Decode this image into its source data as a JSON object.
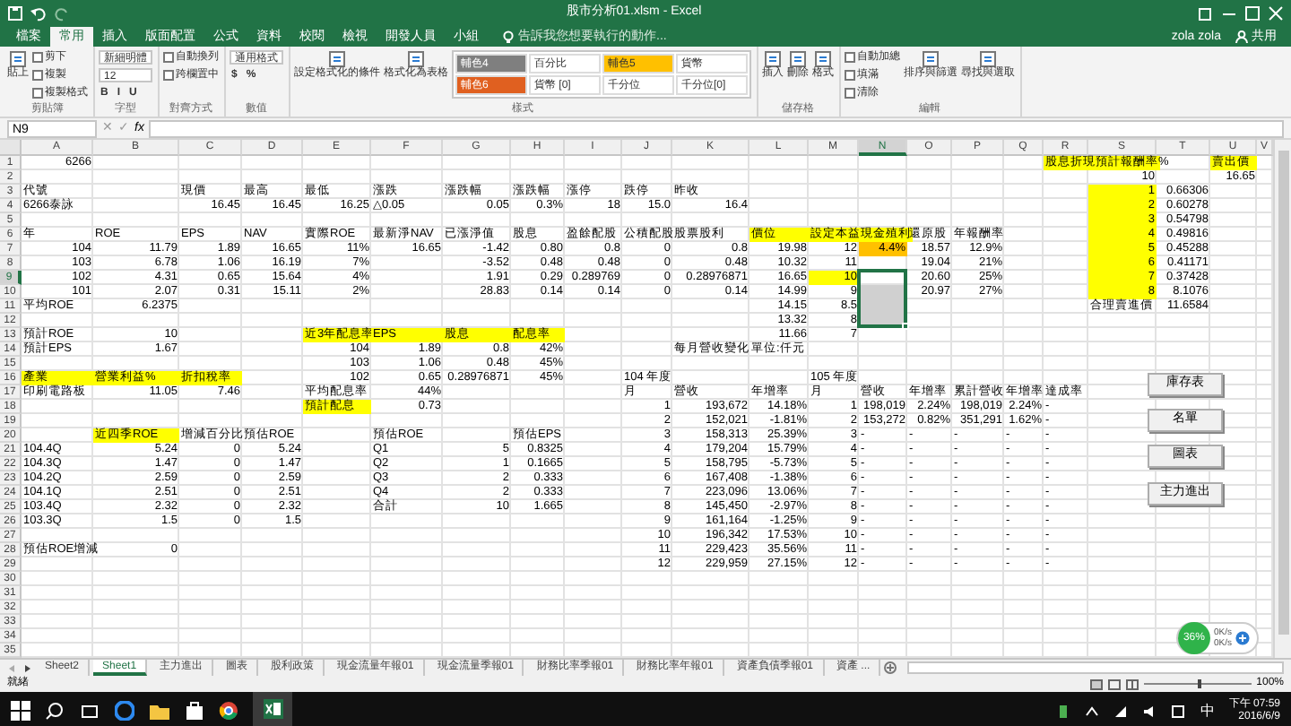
{
  "window": {
    "title": "股市分析01.xlsm - Excel",
    "user": "zola zola",
    "share": "共用"
  },
  "ribbon_tabs": [
    {
      "label": "檔案",
      "selected": false
    },
    {
      "label": "常用",
      "selected": true
    },
    {
      "label": "插入",
      "selected": false
    },
    {
      "label": "版面配置",
      "selected": false
    },
    {
      "label": "公式",
      "selected": false
    },
    {
      "label": "資料",
      "selected": false
    },
    {
      "label": "校閱",
      "selected": false
    },
    {
      "label": "檢視",
      "selected": false
    },
    {
      "label": "開發人員",
      "selected": false
    },
    {
      "label": "小組",
      "selected": false
    }
  ],
  "tell_me": "告訴我您想要執行的動作...",
  "ribbon": {
    "groups": [
      {
        "label": "剪貼簿",
        "items": [
          {
            "text": "貼上",
            "kind": "large"
          },
          {
            "text": "剪下",
            "kind": "small"
          },
          {
            "text": "複製",
            "kind": "small"
          },
          {
            "text": "複製格式",
            "kind": "small"
          }
        ]
      },
      {
        "label": "字型",
        "items": [
          {
            "text": "新細明體",
            "kind": "field"
          },
          {
            "text": "12",
            "kind": "field"
          },
          {
            "text": "B",
            "kind": "toggle"
          },
          {
            "text": "I",
            "kind": "toggle"
          },
          {
            "text": "U",
            "kind": "toggle"
          }
        ]
      },
      {
        "label": "對齊方式",
        "items": [
          {
            "text": "自動換列",
            "kind": "small"
          },
          {
            "text": "跨欄置中",
            "kind": "small"
          }
        ]
      },
      {
        "label": "數值",
        "items": [
          {
            "text": "通用格式",
            "kind": "field"
          },
          {
            "text": "$",
            "kind": "toggle"
          },
          {
            "text": "%",
            "kind": "toggle"
          }
        ]
      },
      {
        "label": "樣式",
        "items": [
          {
            "text": "設定格式化的條件",
            "kind": "large"
          },
          {
            "text": "格式化為表格",
            "kind": "large"
          },
          {
            "text": "輔色4",
            "kind": "swatch",
            "color": "#7f7f7f"
          },
          {
            "text": "百分比",
            "kind": "swatch",
            "color": "#ffffff"
          },
          {
            "text": "輔色5",
            "kind": "swatch",
            "color": "#ffc000"
          },
          {
            "text": "貨幣",
            "kind": "swatch",
            "color": "#ffffff"
          },
          {
            "text": "輔色6",
            "kind": "swatch",
            "color": "#e06020"
          },
          {
            "text": "貨幣 [0]",
            "kind": "swatch",
            "color": "#ffffff"
          },
          {
            "text": "千分位",
            "kind": "swatch",
            "color": "#ffffff"
          },
          {
            "text": "千分位[0]",
            "kind": "swatch",
            "color": "#ffffff"
          }
        ]
      },
      {
        "label": "儲存格",
        "items": [
          {
            "text": "插入",
            "kind": "large"
          },
          {
            "text": "刪除",
            "kind": "large"
          },
          {
            "text": "格式",
            "kind": "large"
          }
        ]
      },
      {
        "label": "編輯",
        "items": [
          {
            "text": "自動加總",
            "kind": "small"
          },
          {
            "text": "填滿",
            "kind": "small"
          },
          {
            "text": "清除",
            "kind": "small"
          },
          {
            "text": "排序與篩選",
            "kind": "large"
          },
          {
            "text": "尋找與選取",
            "kind": "large"
          }
        ]
      }
    ]
  },
  "formula_bar": {
    "name_box": "N9",
    "cancel": "✕",
    "enter": "✓",
    "fx": "fx"
  },
  "columns": [
    {
      "label": "A",
      "selected": false
    },
    {
      "label": "B",
      "selected": false
    },
    {
      "label": "C",
      "selected": false
    },
    {
      "label": "D",
      "selected": false
    },
    {
      "label": "E",
      "selected": false
    },
    {
      "label": "F",
      "selected": false
    },
    {
      "label": "G",
      "selected": false
    },
    {
      "label": "H",
      "selected": false
    },
    {
      "label": "I",
      "selected": false
    },
    {
      "label": "J",
      "selected": false
    },
    {
      "label": "K",
      "selected": false
    },
    {
      "label": "L",
      "selected": false
    },
    {
      "label": "M",
      "selected": false
    },
    {
      "label": "N",
      "selected": true
    },
    {
      "label": "O",
      "selected": false
    },
    {
      "label": "P",
      "selected": false
    },
    {
      "label": "Q",
      "selected": false
    },
    {
      "label": "R",
      "selected": false
    },
    {
      "label": "S",
      "selected": false
    },
    {
      "label": "T",
      "selected": false
    },
    {
      "label": "U",
      "selected": false
    },
    {
      "label": "V",
      "selected": false
    }
  ],
  "rows": [
    {
      "label": "1",
      "selected": false,
      "cells": [
        {
          "text": "6266",
          "kind": "number"
        },
        {},
        {},
        {},
        {},
        {},
        {},
        {},
        {},
        {},
        {},
        {},
        {},
        {},
        {},
        {},
        {},
        {
          "text": "股息折現預計報酬率",
          "kind": "text",
          "color": "#ffff00"
        },
        {},
        {
          "text": "%",
          "kind": "text"
        },
        {
          "text": "賣出價",
          "kind": "text",
          "color": "#ffff00"
        }
      ]
    },
    {
      "label": "2",
      "selected": false,
      "cells": [
        {},
        {},
        {},
        {},
        {},
        {},
        {},
        {},
        {},
        {},
        {},
        {},
        {},
        {},
        {},
        {},
        {},
        {},
        {
          "text": "10",
          "kind": "number"
        },
        {},
        {
          "text": "16.65",
          "kind": "number"
        }
      ]
    },
    {
      "label": "3",
      "selected": false,
      "cells": [
        {
          "text": "代號",
          "kind": "text"
        },
        {},
        {
          "text": "現價",
          "kind": "text"
        },
        {
          "text": "最高",
          "kind": "text"
        },
        {
          "text": "最低",
          "kind": "text"
        },
        {
          "text": "漲跌",
          "kind": "text"
        },
        {
          "text": "漲跌幅",
          "kind": "text"
        },
        {
          "text": "漲跌幅",
          "kind": "text"
        },
        {
          "text": "漲停",
          "kind": "text"
        },
        {
          "text": "跌停",
          "kind": "text"
        },
        {
          "text": "昨收",
          "kind": "text"
        },
        {},
        {},
        {},
        {},
        {},
        {},
        {},
        {
          "text": "1",
          "kind": "number",
          "color": "#ffff00"
        },
        {
          "text": "0.66306",
          "kind": "number"
        }
      ]
    },
    {
      "label": "4",
      "selected": false,
      "cells": [
        {
          "text": "6266泰詠",
          "kind": "text"
        },
        {},
        {
          "text": "16.45",
          "kind": "number"
        },
        {
          "text": "16.45",
          "kind": "number"
        },
        {
          "text": "16.25",
          "kind": "number"
        },
        {
          "text": "△0.05",
          "kind": "text"
        },
        {
          "text": "0.05",
          "kind": "number"
        },
        {
          "text": "0.3%",
          "kind": "number"
        },
        {
          "text": "18",
          "kind": "number"
        },
        {
          "text": "15.0",
          "kind": "number"
        },
        {
          "text": "16.4",
          "kind": "number"
        },
        {},
        {},
        {},
        {},
        {},
        {},
        {},
        {
          "text": "2",
          "kind": "number",
          "color": "#ffff00"
        },
        {
          "text": "0.60278",
          "kind": "number"
        }
      ]
    },
    {
      "label": "5",
      "selected": false,
      "cells": [
        {},
        {},
        {},
        {},
        {},
        {},
        {},
        {},
        {},
        {},
        {},
        {},
        {},
        {},
        {},
        {},
        {},
        {},
        {
          "text": "3",
          "kind": "number",
          "color": "#ffff00"
        },
        {
          "text": "0.54798",
          "kind": "number"
        }
      ]
    },
    {
      "label": "6",
      "selected": false,
      "cells": [
        {
          "text": "年",
          "kind": "text"
        },
        {
          "text": "ROE",
          "kind": "text"
        },
        {
          "text": "EPS",
          "kind": "text"
        },
        {
          "text": "NAV",
          "kind": "text"
        },
        {
          "text": "實際ROE",
          "kind": "text"
        },
        {
          "text": "最新淨NAV",
          "kind": "text"
        },
        {
          "text": "已漲淨值",
          "kind": "text"
        },
        {
          "text": "股息",
          "kind": "text"
        },
        {
          "text": "盈餘配股",
          "kind": "text"
        },
        {
          "text": "公積配股",
          "kind": "text"
        },
        {
          "text": "股票股利",
          "kind": "text"
        },
        {
          "text": "價位",
          "kind": "text",
          "color": "#ffff00"
        },
        {
          "text": "設定本益",
          "kind": "text",
          "color": "#ffff00"
        },
        {
          "text": "現金殖利",
          "kind": "text",
          "color": "#ffff00"
        },
        {
          "text": "還原股",
          "kind": "text"
        },
        {
          "text": "年報酬率",
          "kind": "text"
        },
        {},
        {},
        {
          "text": "4",
          "kind": "number",
          "color": "#ffff00"
        },
        {
          "text": "0.49816",
          "kind": "number"
        }
      ]
    },
    {
      "label": "7",
      "selected": false,
      "cells": [
        {
          "text": "104",
          "kind": "number"
        },
        {
          "text": "11.79",
          "kind": "number"
        },
        {
          "text": "1.89",
          "kind": "number"
        },
        {
          "text": "16.65",
          "kind": "number"
        },
        {
          "text": "11%",
          "kind": "number"
        },
        {
          "text": "16.65",
          "kind": "number"
        },
        {
          "text": "-1.42",
          "kind": "number"
        },
        {
          "text": "0.80",
          "kind": "number"
        },
        {
          "text": "0.8",
          "kind": "number"
        },
        {
          "text": "0",
          "kind": "number"
        },
        {
          "text": "0.8",
          "kind": "number"
        },
        {
          "text": "19.98",
          "kind": "number"
        },
        {
          "text": "12",
          "kind": "number"
        },
        {
          "text": "4.4%",
          "kind": "number",
          "color": "#ffc000"
        },
        {
          "text": "18.57",
          "kind": "number"
        },
        {
          "text": "12.9%",
          "kind": "number"
        },
        {},
        {},
        {
          "text": "5",
          "kind": "number",
          "color": "#ffff00"
        },
        {
          "text": "0.45288",
          "kind": "number"
        }
      ]
    },
    {
      "label": "8",
      "selected": false,
      "cells": [
        {
          "text": "103",
          "kind": "number"
        },
        {
          "text": "6.78",
          "kind": "number"
        },
        {
          "text": "1.06",
          "kind": "number"
        },
        {
          "text": "16.19",
          "kind": "number"
        },
        {
          "text": "7%",
          "kind": "number"
        },
        {},
        {
          "text": "-3.52",
          "kind": "number"
        },
        {
          "text": "0.48",
          "kind": "number"
        },
        {
          "text": "0.48",
          "kind": "number"
        },
        {
          "text": "0",
          "kind": "number"
        },
        {
          "text": "0.48",
          "kind": "number"
        },
        {
          "text": "10.32",
          "kind": "number"
        },
        {
          "text": "11",
          "kind": "number"
        },
        {},
        {
          "text": "19.04",
          "kind": "number"
        },
        {
          "text": "21%",
          "kind": "number"
        },
        {},
        {},
        {
          "text": "6",
          "kind": "number",
          "color": "#ffff00"
        },
        {
          "text": "0.41171",
          "kind": "number"
        }
      ]
    },
    {
      "label": "9",
      "selected": true,
      "cells": [
        {
          "text": "102",
          "kind": "number"
        },
        {
          "text": "4.31",
          "kind": "number"
        },
        {
          "text": "0.65",
          "kind": "number"
        },
        {
          "text": "15.64",
          "kind": "number"
        },
        {
          "text": "4%",
          "kind": "number"
        },
        {},
        {
          "text": "1.91",
          "kind": "number"
        },
        {
          "text": "0.29",
          "kind": "number"
        },
        {
          "text": "0.289769",
          "kind": "number"
        },
        {
          "text": "0",
          "kind": "number"
        },
        {
          "text": "0.28976871",
          "kind": "number"
        },
        {
          "text": "16.65",
          "kind": "number"
        },
        {
          "text": "10",
          "kind": "number",
          "color": "#ffff00"
        },
        {
          "selected": true
        },
        {
          "text": "20.60",
          "kind": "number"
        },
        {
          "text": "25%",
          "kind": "number"
        },
        {},
        {},
        {
          "text": "7",
          "kind": "number",
          "color": "#ffff00"
        },
        {
          "text": "0.37428",
          "kind": "number"
        }
      ]
    },
    {
      "label": "10",
      "selected": false,
      "cells": [
        {
          "text": "101",
          "kind": "number"
        },
        {
          "text": "2.07",
          "kind": "number"
        },
        {
          "text": "0.31",
          "kind": "number"
        },
        {
          "text": "15.11",
          "kind": "number"
        },
        {
          "text": "2%",
          "kind": "number"
        },
        {},
        {
          "text": "28.83",
          "kind": "number"
        },
        {
          "text": "0.14",
          "kind": "number"
        },
        {
          "text": "0.14",
          "kind": "number"
        },
        {
          "text": "0",
          "kind": "number"
        },
        {
          "text": "0.14",
          "kind": "number"
        },
        {
          "text": "14.99",
          "kind": "number"
        },
        {
          "text": "9",
          "kind": "number"
        },
        {
          "color": "#d0d0d0",
          "selected": true
        },
        {
          "text": "20.97",
          "kind": "number"
        },
        {
          "text": "27%",
          "kind": "number"
        },
        {},
        {},
        {
          "text": "8",
          "kind": "number",
          "color": "#ffff00"
        },
        {
          "text": "8.1076",
          "kind": "number"
        }
      ]
    },
    {
      "label": "11",
      "selected": false,
      "cells": [
        {
          "text": "平均ROE",
          "kind": "text"
        },
        {
          "text": "6.2375",
          "kind": "number"
        },
        {},
        {},
        {},
        {},
        {},
        {},
        {},
        {},
        {},
        {
          "text": "14.15",
          "kind": "number"
        },
        {
          "text": "8.5",
          "kind": "number"
        },
        {
          "color": "#d0d0d0",
          "selected": true
        },
        {},
        {},
        {},
        {},
        {
          "text": "合理賣進價",
          "kind": "text"
        },
        {
          "text": "11.6584",
          "kind": "number"
        }
      ]
    },
    {
      "label": "12",
      "selected": false,
      "cells": [
        {},
        {},
        {},
        {},
        {},
        {},
        {},
        {},
        {},
        {},
        {},
        {
          "text": "13.32",
          "kind": "number"
        },
        {
          "text": "8",
          "kind": "number"
        },
        {
          "color": "#d0d0d0",
          "selected": true
        }
      ]
    },
    {
      "label": "13",
      "selected": false,
      "cells": [
        {
          "text": "預計ROE",
          "kind": "text"
        },
        {
          "text": "10",
          "kind": "number"
        },
        {},
        {},
        {
          "text": "近3年配息率",
          "kind": "text",
          "color": "#ffff00"
        },
        {
          "text": "EPS",
          "kind": "text",
          "color": "#ffff00"
        },
        {
          "text": "股息",
          "kind": "text",
          "color": "#ffff00"
        },
        {
          "text": "配息率",
          "kind": "text",
          "color": "#ffff00"
        },
        {},
        {},
        {},
        {
          "text": "11.66",
          "kind": "number"
        },
        {
          "text": "7",
          "kind": "number"
        }
      ]
    },
    {
      "label": "14",
      "selected": false,
      "cells": [
        {
          "text": "預計EPS",
          "kind": "text"
        },
        {
          "text": "1.67",
          "kind": "number"
        },
        {},
        {},
        {
          "text": "104",
          "kind": "number"
        },
        {
          "text": "1.89",
          "kind": "number"
        },
        {
          "text": "0.8",
          "kind": "number"
        },
        {
          "text": "42%",
          "kind": "number"
        },
        {},
        {},
        {
          "text": "每月營收變化",
          "kind": "text"
        },
        {
          "text": "單位:仟元",
          "kind": "text"
        }
      ]
    },
    {
      "label": "15",
      "selected": false,
      "cells": [
        {},
        {},
        {},
        {},
        {
          "text": "103",
          "kind": "number"
        },
        {
          "text": "1.06",
          "kind": "number"
        },
        {
          "text": "0.48",
          "kind": "number"
        },
        {
          "text": "45%",
          "kind": "number"
        }
      ]
    },
    {
      "label": "16",
      "selected": false,
      "cells": [
        {
          "text": "產業",
          "kind": "text",
          "color": "#ffff00"
        },
        {
          "text": "營業利益%",
          "kind": "text",
          "color": "#ffff00"
        },
        {
          "text": "折扣稅率",
          "kind": "text",
          "color": "#ffff00"
        },
        {},
        {
          "text": "102",
          "kind": "number"
        },
        {
          "text": "0.65",
          "kind": "number"
        },
        {
          "text": "0.28976871",
          "kind": "number"
        },
        {
          "text": "45%",
          "kind": "number"
        },
        {},
        {
          "text": "104 年度",
          "kind": "text"
        },
        {},
        {},
        {
          "text": "105 年度",
          "kind": "text"
        }
      ]
    },
    {
      "label": "17",
      "selected": false,
      "cells": [
        {
          "text": "印刷電路板",
          "kind": "text"
        },
        {
          "text": "11.05",
          "kind": "number"
        },
        {
          "text": "7.46",
          "kind": "number"
        },
        {},
        {
          "text": "平均配息率",
          "kind": "text"
        },
        {
          "text": "44%",
          "kind": "number"
        },
        {},
        {},
        {},
        {
          "text": "月",
          "kind": "text"
        },
        {
          "text": "營收",
          "kind": "text"
        },
        {
          "text": "年增率",
          "kind": "text"
        },
        {
          "text": "月",
          "kind": "text"
        },
        {
          "text": "營收",
          "kind": "text"
        },
        {
          "text": "年增率",
          "kind": "text"
        },
        {
          "text": "累計營收",
          "kind": "text"
        },
        {
          "text": "年增率",
          "kind": "text"
        },
        {
          "text": "達成率",
          "kind": "text"
        }
      ]
    },
    {
      "label": "18",
      "selected": false,
      "cells": [
        {},
        {},
        {},
        {},
        {
          "text": "預計配息",
          "kind": "text",
          "color": "#ffff00"
        },
        {
          "text": "0.73",
          "kind": "number"
        },
        {},
        {},
        {},
        {
          "text": "1",
          "kind": "number"
        },
        {
          "text": "193,672",
          "kind": "number"
        },
        {
          "text": "14.18%",
          "kind": "number"
        },
        {
          "text": "1",
          "kind": "number"
        },
        {
          "text": "198,019",
          "kind": "number"
        },
        {
          "text": "2.24%",
          "kind": "number"
        },
        {
          "text": "198,019",
          "kind": "number"
        },
        {
          "text": "2.24%",
          "kind": "number"
        },
        {
          "text": "-",
          "kind": "text"
        }
      ]
    },
    {
      "label": "19",
      "selected": false,
      "cells": [
        {},
        {},
        {},
        {},
        {},
        {},
        {},
        {},
        {},
        {
          "text": "2",
          "kind": "number"
        },
        {
          "text": "152,021",
          "kind": "number"
        },
        {
          "text": "-1.81%",
          "kind": "number"
        },
        {
          "text": "2",
          "kind": "number"
        },
        {
          "text": "153,272",
          "kind": "number"
        },
        {
          "text": "0.82%",
          "kind": "number"
        },
        {
          "text": "351,291",
          "kind": "number"
        },
        {
          "text": "1.62%",
          "kind": "number"
        },
        {
          "text": "-",
          "kind": "text"
        }
      ]
    },
    {
      "label": "20",
      "selected": false,
      "cells": [
        {},
        {
          "text": "近四季ROE",
          "kind": "text",
          "color": "#ffff00"
        },
        {
          "text": "增減百分比",
          "kind": "text"
        },
        {
          "text": "預估ROE",
          "kind": "text"
        },
        {},
        {
          "text": "預估ROE",
          "kind": "text"
        },
        {},
        {
          "text": "預估EPS",
          "kind": "text"
        },
        {},
        {
          "text": "3",
          "kind": "number"
        },
        {
          "text": "158,313",
          "kind": "number"
        },
        {
          "text": "25.39%",
          "kind": "number"
        },
        {
          "text": "3",
          "kind": "number"
        },
        {
          "text": "-",
          "kind": "text"
        },
        {
          "text": "-",
          "kind": "text"
        },
        {
          "text": "-",
          "kind": "text"
        },
        {
          "text": "-",
          "kind": "text"
        },
        {
          "text": "-",
          "kind": "text"
        }
      ]
    },
    {
      "label": "21",
      "selected": false,
      "cells": [
        {
          "text": "104.4Q",
          "kind": "text"
        },
        {
          "text": "5.24",
          "kind": "number"
        },
        {
          "text": "0",
          "kind": "number"
        },
        {
          "text": "5.24",
          "kind": "number"
        },
        {},
        {
          "text": "Q1",
          "kind": "text"
        },
        {
          "text": "5",
          "kind": "number"
        },
        {
          "text": "0.8325",
          "kind": "number"
        },
        {},
        {
          "text": "4",
          "kind": "number"
        },
        {
          "text": "179,204",
          "kind": "number"
        },
        {
          "text": "15.79%",
          "kind": "number"
        },
        {
          "text": "4",
          "kind": "number"
        },
        {
          "text": "-",
          "kind": "text"
        },
        {
          "text": "-",
          "kind": "text"
        },
        {
          "text": "-",
          "kind": "text"
        },
        {
          "text": "-",
          "kind": "text"
        },
        {
          "text": "-",
          "kind": "text"
        }
      ]
    },
    {
      "label": "22",
      "selected": false,
      "cells": [
        {
          "text": "104.3Q",
          "kind": "text"
        },
        {
          "text": "1.47",
          "kind": "number"
        },
        {
          "text": "0",
          "kind": "number"
        },
        {
          "text": "1.47",
          "kind": "number"
        },
        {},
        {
          "text": "Q2",
          "kind": "text"
        },
        {
          "text": "1",
          "kind": "number"
        },
        {
          "text": "0.1665",
          "kind": "number"
        },
        {},
        {
          "text": "5",
          "kind": "number"
        },
        {
          "text": "158,795",
          "kind": "number"
        },
        {
          "text": "-5.73%",
          "kind": "number"
        },
        {
          "text": "5",
          "kind": "number"
        },
        {
          "text": "-",
          "kind": "text"
        },
        {
          "text": "-",
          "kind": "text"
        },
        {
          "text": "-",
          "kind": "text"
        },
        {
          "text": "-",
          "kind": "text"
        },
        {
          "text": "-",
          "kind": "text"
        }
      ]
    },
    {
      "label": "23",
      "selected": false,
      "cells": [
        {
          "text": "104.2Q",
          "kind": "text"
        },
        {
          "text": "2.59",
          "kind": "number"
        },
        {
          "text": "0",
          "kind": "number"
        },
        {
          "text": "2.59",
          "kind": "number"
        },
        {},
        {
          "text": "Q3",
          "kind": "text"
        },
        {
          "text": "2",
          "kind": "number"
        },
        {
          "text": "0.333",
          "kind": "number"
        },
        {},
        {
          "text": "6",
          "kind": "number"
        },
        {
          "text": "167,408",
          "kind": "number"
        },
        {
          "text": "-1.38%",
          "kind": "number"
        },
        {
          "text": "6",
          "kind": "number"
        },
        {
          "text": "-",
          "kind": "text"
        },
        {
          "text": "-",
          "kind": "text"
        },
        {
          "text": "-",
          "kind": "text"
        },
        {
          "text": "-",
          "kind": "text"
        },
        {
          "text": "-",
          "kind": "text"
        }
      ]
    },
    {
      "label": "24",
      "selected": false,
      "cells": [
        {
          "text": "104.1Q",
          "kind": "text"
        },
        {
          "text": "2.51",
          "kind": "number"
        },
        {
          "text": "0",
          "kind": "number"
        },
        {
          "text": "2.51",
          "kind": "number"
        },
        {},
        {
          "text": "Q4",
          "kind": "text"
        },
        {
          "text": "2",
          "kind": "number"
        },
        {
          "text": "0.333",
          "kind": "number"
        },
        {},
        {
          "text": "7",
          "kind": "number"
        },
        {
          "text": "223,096",
          "kind": "number"
        },
        {
          "text": "13.06%",
          "kind": "number"
        },
        {
          "text": "7",
          "kind": "number"
        },
        {
          "text": "-",
          "kind": "text"
        },
        {
          "text": "-",
          "kind": "text"
        },
        {
          "text": "-",
          "kind": "text"
        },
        {
          "text": "-",
          "kind": "text"
        },
        {
          "text": "-",
          "kind": "text"
        }
      ]
    },
    {
      "label": "25",
      "selected": false,
      "cells": [
        {
          "text": "103.4Q",
          "kind": "text"
        },
        {
          "text": "2.32",
          "kind": "number"
        },
        {
          "text": "0",
          "kind": "number"
        },
        {
          "text": "2.32",
          "kind": "number"
        },
        {},
        {
          "text": "合計",
          "kind": "text"
        },
        {
          "text": "10",
          "kind": "number"
        },
        {
          "text": "1.665",
          "kind": "number"
        },
        {},
        {
          "text": "8",
          "kind": "number"
        },
        {
          "text": "145,450",
          "kind": "number"
        },
        {
          "text": "-2.97%",
          "kind": "number"
        },
        {
          "text": "8",
          "kind": "number"
        },
        {
          "text": "-",
          "kind": "text"
        },
        {
          "text": "-",
          "kind": "text"
        },
        {
          "text": "-",
          "kind": "text"
        },
        {
          "text": "-",
          "kind": "text"
        },
        {
          "text": "-",
          "kind": "text"
        }
      ]
    },
    {
      "label": "26",
      "selected": false,
      "cells": [
        {
          "text": "103.3Q",
          "kind": "text"
        },
        {
          "text": "1.5",
          "kind": "number"
        },
        {
          "text": "0",
          "kind": "number"
        },
        {
          "text": "1.5",
          "kind": "number"
        },
        {},
        {},
        {},
        {},
        {},
        {
          "text": "9",
          "kind": "number"
        },
        {
          "text": "161,164",
          "kind": "number"
        },
        {
          "text": "-1.25%",
          "kind": "number"
        },
        {
          "text": "9",
          "kind": "number"
        },
        {
          "text": "-",
          "kind": "text"
        },
        {
          "text": "-",
          "kind": "text"
        },
        {
          "text": "-",
          "kind": "text"
        },
        {
          "text": "-",
          "kind": "text"
        },
        {
          "text": "-",
          "kind": "text"
        }
      ]
    },
    {
      "label": "27",
      "selected": false,
      "cells": [
        {},
        {},
        {},
        {},
        {},
        {},
        {},
        {},
        {},
        {
          "text": "10",
          "kind": "number"
        },
        {
          "text": "196,342",
          "kind": "number"
        },
        {
          "text": "17.53%",
          "kind": "number"
        },
        {
          "text": "10",
          "kind": "number"
        },
        {
          "text": "-",
          "kind": "text"
        },
        {
          "text": "-",
          "kind": "text"
        },
        {
          "text": "-",
          "kind": "text"
        },
        {
          "text": "-",
          "kind": "text"
        },
        {
          "text": "-",
          "kind": "text"
        }
      ]
    },
    {
      "label": "28",
      "selected": false,
      "cells": [
        {
          "text": "預估ROE增減",
          "kind": "text"
        },
        {
          "text": "0",
          "kind": "number"
        },
        {},
        {},
        {},
        {},
        {},
        {},
        {},
        {
          "text": "11",
          "kind": "number"
        },
        {
          "text": "229,423",
          "kind": "number"
        },
        {
          "text": "35.56%",
          "kind": "number"
        },
        {
          "text": "11",
          "kind": "number"
        },
        {
          "text": "-",
          "kind": "text"
        },
        {
          "text": "-",
          "kind": "text"
        },
        {
          "text": "-",
          "kind": "text"
        },
        {
          "text": "-",
          "kind": "text"
        },
        {
          "text": "-",
          "kind": "text"
        }
      ]
    },
    {
      "label": "29",
      "selected": false,
      "cells": [
        {},
        {},
        {},
        {},
        {},
        {},
        {},
        {},
        {},
        {
          "text": "12",
          "kind": "number"
        },
        {
          "text": "229,959",
          "kind": "number"
        },
        {
          "text": "27.15%",
          "kind": "number"
        },
        {
          "text": "12",
          "kind": "number"
        },
        {
          "text": "-",
          "kind": "text"
        },
        {
          "text": "-",
          "kind": "text"
        },
        {
          "text": "-",
          "kind": "text"
        },
        {
          "text": "-",
          "kind": "text"
        },
        {
          "text": "-",
          "kind": "text"
        }
      ]
    },
    {
      "label": "30",
      "selected": false
    },
    {
      "label": "31",
      "selected": false
    },
    {
      "label": "32",
      "selected": false
    },
    {
      "label": "33",
      "selected": false
    },
    {
      "label": "34",
      "selected": false
    },
    {
      "label": "35",
      "selected": false
    }
  ],
  "sheet_buttons": [
    "庫存表",
    "名單",
    "圖表",
    "主力進出"
  ],
  "sheet_tabs": [
    {
      "label": "Sheet2",
      "selected": false
    },
    {
      "label": "Sheet1",
      "selected": true
    },
    {
      "label": "主力進出",
      "selected": false
    },
    {
      "label": "圖表",
      "selected": false
    },
    {
      "label": "股利政策",
      "selected": false
    },
    {
      "label": "現金流量年報01",
      "selected": false
    },
    {
      "label": "現金流量季報01",
      "selected": false
    },
    {
      "label": "財務比率季報01",
      "selected": false
    },
    {
      "label": "財務比率年報01",
      "selected": false
    },
    {
      "label": "資產負債季報01",
      "selected": false
    },
    {
      "label": "資產 ...",
      "selected": false
    }
  ],
  "status_bar": {
    "text": "就緒",
    "zoom": "100%",
    "zoom_slider": {
      "level": 0.5
    }
  },
  "monitor": {
    "percent": "36%",
    "up": "0K/s",
    "down": "0K/s"
  },
  "taskbar": {
    "time": "下午 07:59",
    "date": "2016/6/9",
    "ime": "中"
  }
}
